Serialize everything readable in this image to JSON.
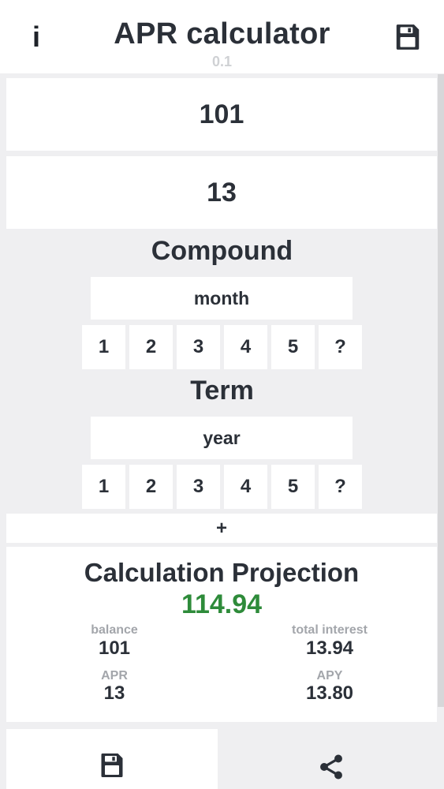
{
  "header": {
    "info_label": "i",
    "title": "APR calculator",
    "subvalue": "0.1"
  },
  "inputs": {
    "principal": "101",
    "rate": "13"
  },
  "compound": {
    "title": "Compound",
    "selected": "month",
    "chips": [
      "1",
      "2",
      "3",
      "4",
      "5",
      "?"
    ]
  },
  "term": {
    "title": "Term",
    "selected": "year",
    "chips": [
      "1",
      "2",
      "3",
      "4",
      "5",
      "?"
    ]
  },
  "plus_label": "+",
  "projection": {
    "title": "Calculation Projection",
    "total": "114.94",
    "balance_label": "balance",
    "balance_value": "101",
    "interest_label": "total interest",
    "interest_value": "13.94",
    "apr_label": "APR",
    "apr_value": "13",
    "apy_label": "APY",
    "apy_value": "13.80"
  },
  "icons": {
    "save": "save-icon",
    "share": "share-icon"
  },
  "colors": {
    "accent_green": "#2e8b3a",
    "text_dark": "#2b3038",
    "background": "#efeff1"
  }
}
